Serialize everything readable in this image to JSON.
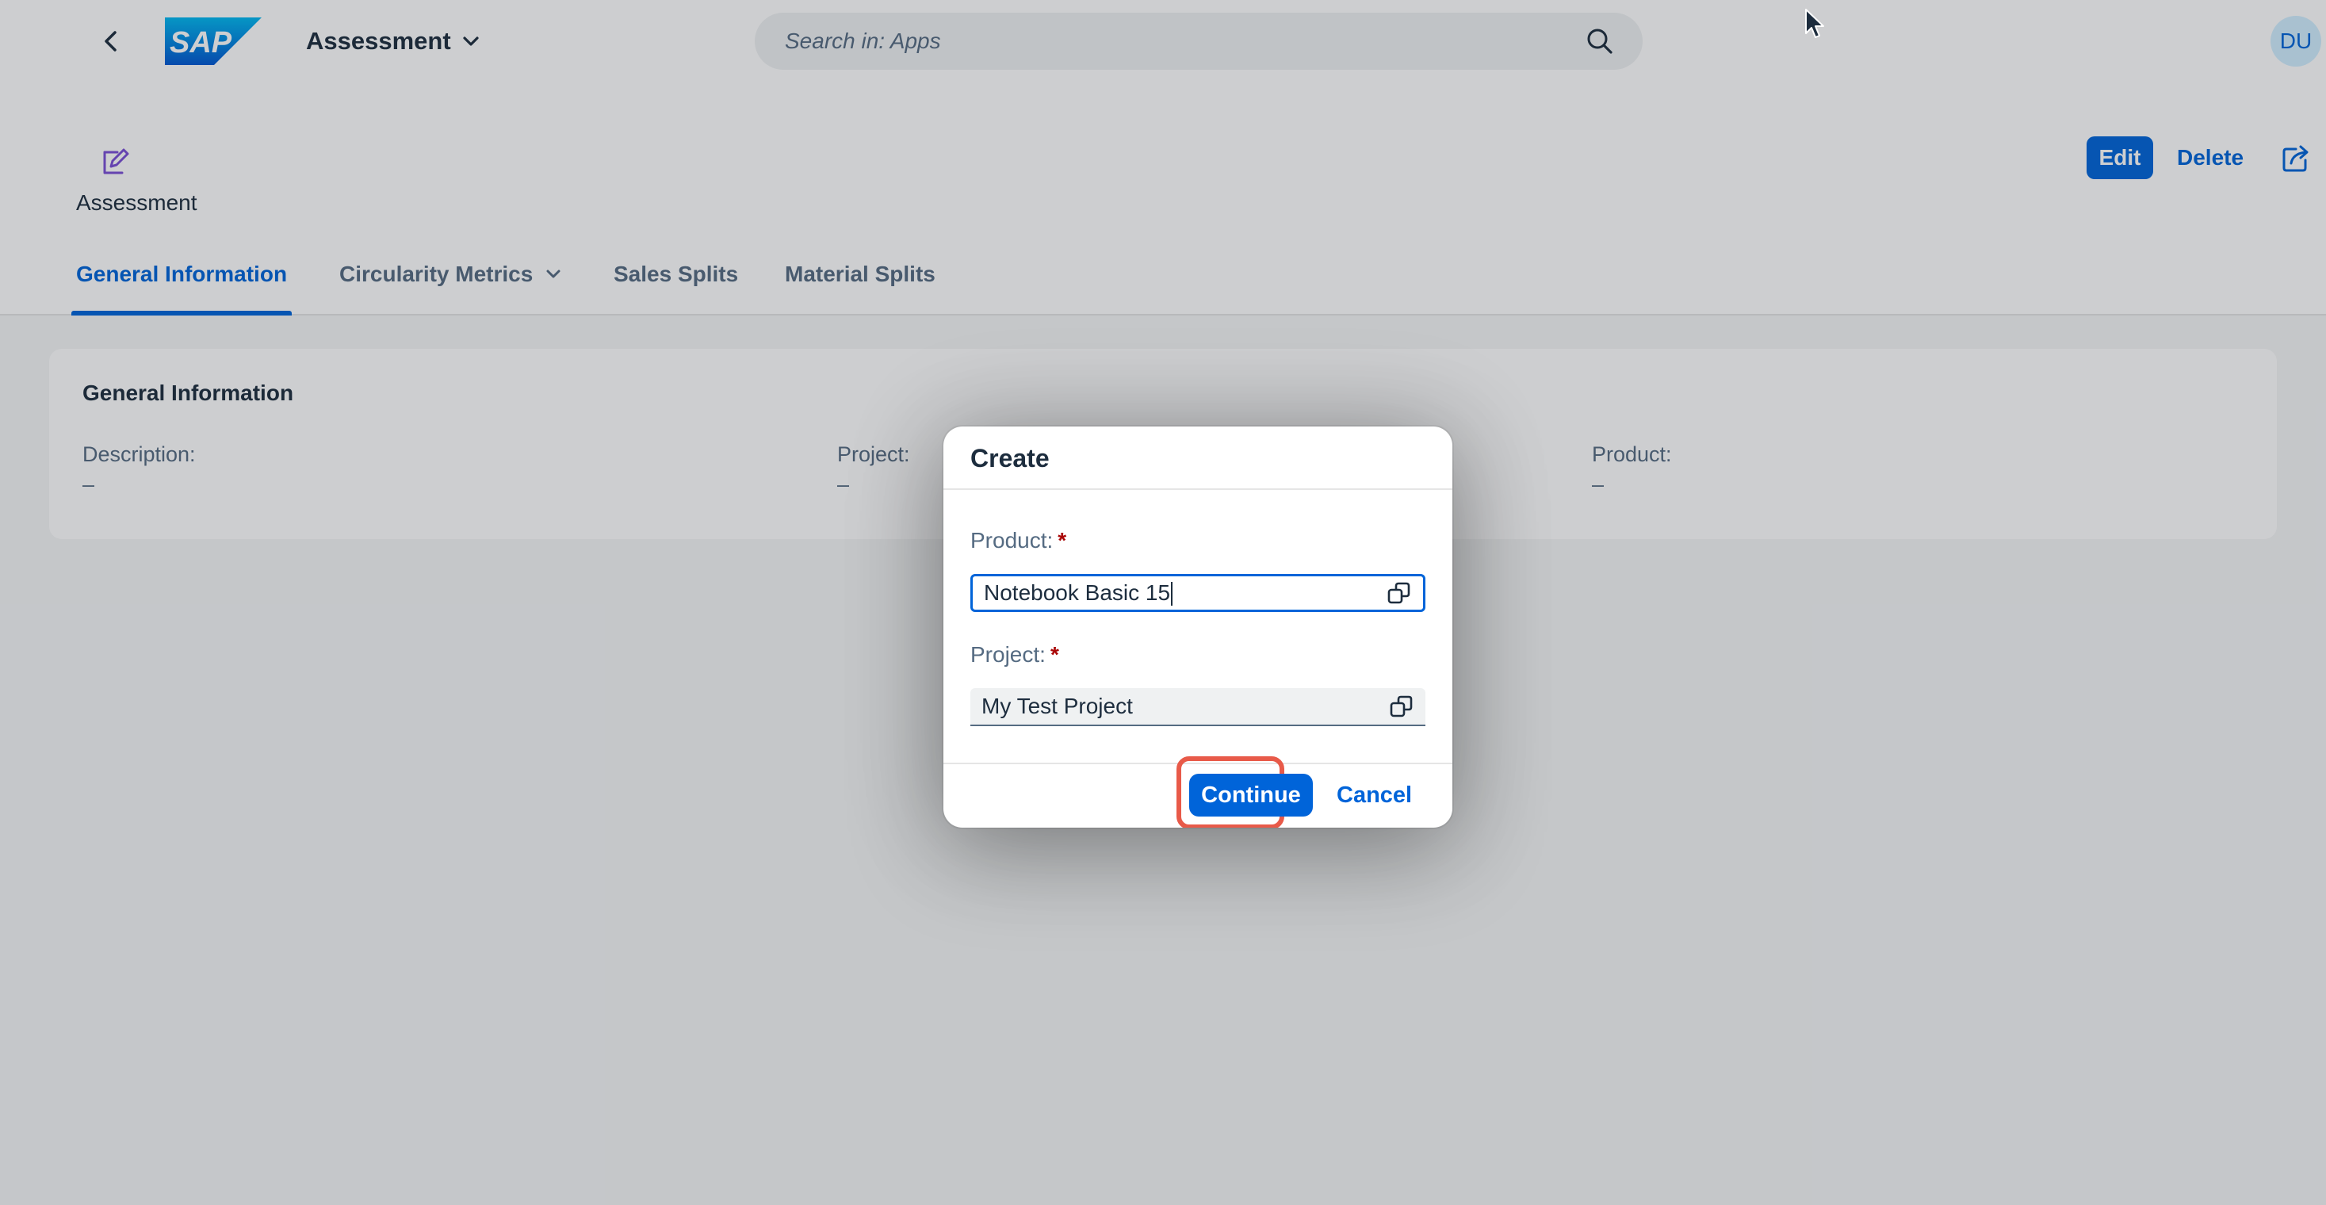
{
  "shell": {
    "app_title": "Assessment",
    "logo_text": "SAP",
    "search_placeholder": "Search in: Apps",
    "avatar_initials": "DU"
  },
  "header": {
    "object_title": "Assessment",
    "edit_label": "Edit",
    "delete_label": "Delete"
  },
  "tabs": [
    {
      "label": "General Information",
      "active": true
    },
    {
      "label": "Circularity Metrics",
      "has_dropdown": true
    },
    {
      "label": "Sales Splits"
    },
    {
      "label": "Material Splits"
    }
  ],
  "section": {
    "title": "General Information",
    "fields": [
      {
        "label": "Description:",
        "value": "–"
      },
      {
        "label": "Project:",
        "value": "–"
      },
      {
        "label": "Product:",
        "value": "–"
      }
    ]
  },
  "dialog": {
    "title": "Create",
    "product_label": "Product:",
    "product_value": "Notebook Basic 15",
    "project_label": "Project:",
    "project_value": "My Test Project",
    "required_marker": "*",
    "continue_label": "Continue",
    "cancel_label": "Cancel"
  },
  "colors": {
    "brand_blue": "#0064d9",
    "highlight": "#e85a49",
    "required": "#aa0808"
  }
}
